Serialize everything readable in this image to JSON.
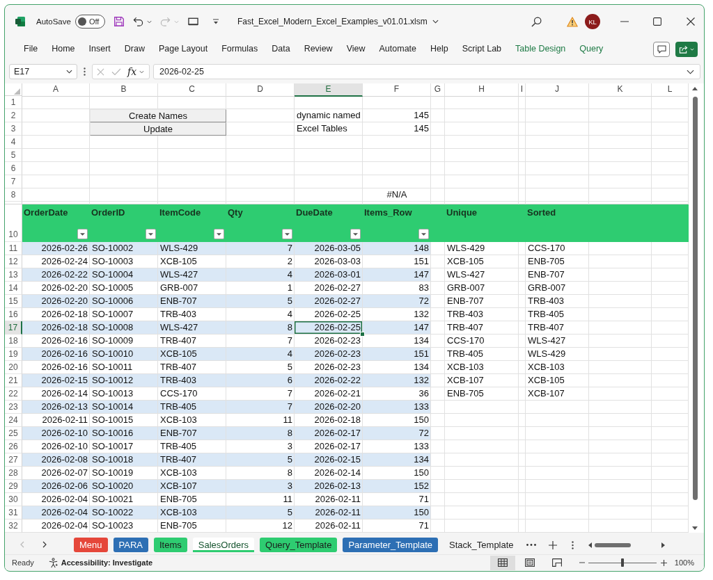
{
  "title_bar": {
    "autosave_label": "AutoSave",
    "autosave": {
      "on": false,
      "label": "Off"
    },
    "undo": {
      "disabled": false
    },
    "redo": {
      "disabled": true
    },
    "file_name": "Fast_Excel_Modern_Excel_Examples_v01.01.xlsm",
    "avatar": "KL"
  },
  "ribbon_tabs": [
    {
      "label": "File",
      "kind": "standard",
      "selected": false
    },
    {
      "label": "Home",
      "kind": "standard",
      "selected": false
    },
    {
      "label": "Insert",
      "kind": "standard",
      "selected": false
    },
    {
      "label": "Draw",
      "kind": "standard",
      "selected": false
    },
    {
      "label": "Page Layout",
      "kind": "standard",
      "selected": false
    },
    {
      "label": "Formulas",
      "kind": "standard",
      "selected": false
    },
    {
      "label": "Data",
      "kind": "standard",
      "selected": false
    },
    {
      "label": "Review",
      "kind": "standard",
      "selected": false
    },
    {
      "label": "View",
      "kind": "standard",
      "selected": false
    },
    {
      "label": "Automate",
      "kind": "standard",
      "selected": false
    },
    {
      "label": "Help",
      "kind": "standard",
      "selected": false
    },
    {
      "label": "Script Lab",
      "kind": "standard",
      "selected": false
    },
    {
      "label": "Table Design",
      "kind": "contextual",
      "selected": false
    },
    {
      "label": "Query",
      "kind": "contextual",
      "selected": false
    }
  ],
  "formula_bar": {
    "name_box": "E17",
    "edit_buttons": {
      "disabled": true
    },
    "function_label": "fx",
    "formula": "2026-02-25"
  },
  "columns": [
    {
      "label": "A",
      "selected": false
    },
    {
      "label": "B",
      "selected": false
    },
    {
      "label": "C",
      "selected": false
    },
    {
      "label": "D",
      "selected": false
    },
    {
      "label": "E",
      "selected": true
    },
    {
      "label": "F",
      "selected": false
    },
    {
      "label": "G",
      "selected": false
    },
    {
      "label": "H",
      "selected": false
    },
    {
      "label": "I",
      "selected": false
    },
    {
      "label": "J",
      "selected": false
    },
    {
      "label": "K",
      "selected": false
    },
    {
      "label": "L",
      "selected": false
    }
  ],
  "top_rows": [
    {
      "header": "1",
      "selected": false
    },
    {
      "header": "2",
      "selected": false,
      "button": "Create Names",
      "label": "dynamic named",
      "value": {
        "text": "145",
        "kind": "number"
      }
    },
    {
      "header": "3",
      "selected": false,
      "button": "Update",
      "label": "Excel Tables",
      "value": {
        "text": "145",
        "kind": "number"
      }
    },
    {
      "header": "4",
      "selected": false
    },
    {
      "header": "5",
      "selected": false
    },
    {
      "header": "6",
      "selected": false
    },
    {
      "header": "7",
      "selected": false
    },
    {
      "header": "8",
      "selected": false,
      "value": {
        "text": "#N/A",
        "kind": "error"
      }
    }
  ],
  "table": {
    "header_row": {
      "header": "10",
      "selected": false
    },
    "columns": [
      {
        "label": "OrderDate",
        "kind": "date"
      },
      {
        "label": "OrderID",
        "kind": "text"
      },
      {
        "label": "ItemCode",
        "kind": "text"
      },
      {
        "label": "Qty",
        "kind": "number"
      },
      {
        "label": "DueDate",
        "kind": "date"
      },
      {
        "label": "Items_Row",
        "kind": "number"
      }
    ],
    "spill_columns": [
      "Unique",
      "Sorted"
    ],
    "rows": [
      {
        "header": "11",
        "selected": false,
        "cells": [
          "2026-02-26",
          "SO-10002",
          "WLS-429",
          "7",
          "2026-03-05",
          "148"
        ],
        "spill": [
          "WLS-429",
          "CCS-170"
        ]
      },
      {
        "header": "12",
        "selected": false,
        "cells": [
          "2026-02-24",
          "SO-10003",
          "XCB-105",
          "2",
          "2026-03-03",
          "151"
        ],
        "spill": [
          "XCB-105",
          "ENB-705"
        ]
      },
      {
        "header": "13",
        "selected": false,
        "cells": [
          "2026-02-22",
          "SO-10004",
          "WLS-427",
          "4",
          "2026-03-01",
          "147"
        ],
        "spill": [
          "WLS-427",
          "ENB-707"
        ]
      },
      {
        "header": "14",
        "selected": false,
        "cells": [
          "2026-02-20",
          "SO-10005",
          "GRB-007",
          "1",
          "2026-02-27",
          "83"
        ],
        "spill": [
          "GRB-007",
          "GRB-007"
        ]
      },
      {
        "header": "15",
        "selected": false,
        "cells": [
          "2026-02-20",
          "SO-10006",
          "ENB-707",
          "5",
          "2026-02-27",
          "72"
        ],
        "spill": [
          "ENB-707",
          "TRB-403"
        ]
      },
      {
        "header": "16",
        "selected": false,
        "cells": [
          "2026-02-18",
          "SO-10007",
          "TRB-403",
          "4",
          "2026-02-25",
          "132"
        ],
        "spill": [
          "TRB-403",
          "TRB-405"
        ]
      },
      {
        "header": "17",
        "selected": true,
        "cells": [
          "2026-02-18",
          "SO-10008",
          "WLS-427",
          "8",
          "2026-02-25",
          "147"
        ],
        "spill": [
          "TRB-407",
          "TRB-407"
        ]
      },
      {
        "header": "18",
        "selected": false,
        "cells": [
          "2026-02-16",
          "SO-10009",
          "TRB-407",
          "7",
          "2026-02-23",
          "134"
        ],
        "spill": [
          "CCS-170",
          "WLS-427"
        ]
      },
      {
        "header": "19",
        "selected": false,
        "cells": [
          "2026-02-16",
          "SO-10010",
          "XCB-105",
          "4",
          "2026-02-23",
          "151"
        ],
        "spill": [
          "TRB-405",
          "WLS-429"
        ]
      },
      {
        "header": "20",
        "selected": false,
        "cells": [
          "2026-02-16",
          "SO-10011",
          "TRB-407",
          "5",
          "2026-02-23",
          "134"
        ],
        "spill": [
          "XCB-103",
          "XCB-103"
        ]
      },
      {
        "header": "21",
        "selected": false,
        "cells": [
          "2026-02-15",
          "SO-10012",
          "TRB-403",
          "6",
          "2026-02-22",
          "132"
        ],
        "spill": [
          "XCB-107",
          "XCB-105"
        ]
      },
      {
        "header": "22",
        "selected": false,
        "cells": [
          "2026-02-14",
          "SO-10013",
          "CCS-170",
          "7",
          "2026-02-21",
          "36"
        ],
        "spill": [
          "ENB-705",
          "XCB-107"
        ]
      },
      {
        "header": "23",
        "selected": false,
        "cells": [
          "2026-02-13",
          "SO-10014",
          "TRB-405",
          "7",
          "2026-02-20",
          "133"
        ]
      },
      {
        "header": "24",
        "selected": false,
        "cells": [
          "2026-02-11",
          "SO-10015",
          "XCB-103",
          "11",
          "2026-02-18",
          "150"
        ]
      },
      {
        "header": "25",
        "selected": false,
        "cells": [
          "2026-02-10",
          "SO-10016",
          "ENB-707",
          "8",
          "2026-02-17",
          "72"
        ]
      },
      {
        "header": "26",
        "selected": false,
        "cells": [
          "2026-02-10",
          "SO-10017",
          "TRB-405",
          "3",
          "2026-02-17",
          "133"
        ]
      },
      {
        "header": "27",
        "selected": false,
        "cells": [
          "2026-02-08",
          "SO-10018",
          "TRB-407",
          "5",
          "2026-02-15",
          "134"
        ]
      },
      {
        "header": "28",
        "selected": false,
        "cells": [
          "2026-02-07",
          "SO-10019",
          "XCB-103",
          "8",
          "2026-02-14",
          "150"
        ]
      },
      {
        "header": "29",
        "selected": false,
        "cells": [
          "2026-02-06",
          "SO-10020",
          "XCB-107",
          "3",
          "2026-02-13",
          "152"
        ]
      },
      {
        "header": "30",
        "selected": false,
        "cells": [
          "2026-02-04",
          "SO-10021",
          "ENB-705",
          "11",
          "2026-02-11",
          "71"
        ]
      },
      {
        "header": "31",
        "selected": false,
        "cells": [
          "2026-02-04",
          "SO-10022",
          "XCB-103",
          "5",
          "2026-02-11",
          "150"
        ]
      },
      {
        "header": "32",
        "selected": false,
        "cells": [
          "2026-02-04",
          "SO-10023",
          "ENB-705",
          "12",
          "2026-02-11",
          "71"
        ]
      }
    ]
  },
  "sheet_nav": {
    "prev_disabled": true,
    "next_disabled": false
  },
  "sheet_tabs": [
    {
      "label": "Menu",
      "color": "#e5473a",
      "selected": false
    },
    {
      "label": "PARA",
      "color": "#2d6fb4",
      "selected": false
    },
    {
      "label": "Items",
      "color": "#2ecc71",
      "selected": false
    },
    {
      "label": "SalesOrders",
      "color": "#2ecc71",
      "selected": true
    },
    {
      "label": "Query_Template",
      "color": "#2ecc71",
      "selected": false
    },
    {
      "label": "Parameter_Template",
      "color": "#2d6fb4",
      "selected": false
    },
    {
      "label": "Stack_Template",
      "selected": false
    }
  ],
  "status_bar": {
    "status": "Ready",
    "accessibility": "Accessibility: Investigate",
    "views": [
      {
        "kind": "normal",
        "selected": true
      },
      {
        "kind": "page_layout",
        "selected": false
      },
      {
        "kind": "page_break",
        "selected": false
      }
    ],
    "zoom": {
      "level": 0.5,
      "reading": "100%"
    }
  }
}
